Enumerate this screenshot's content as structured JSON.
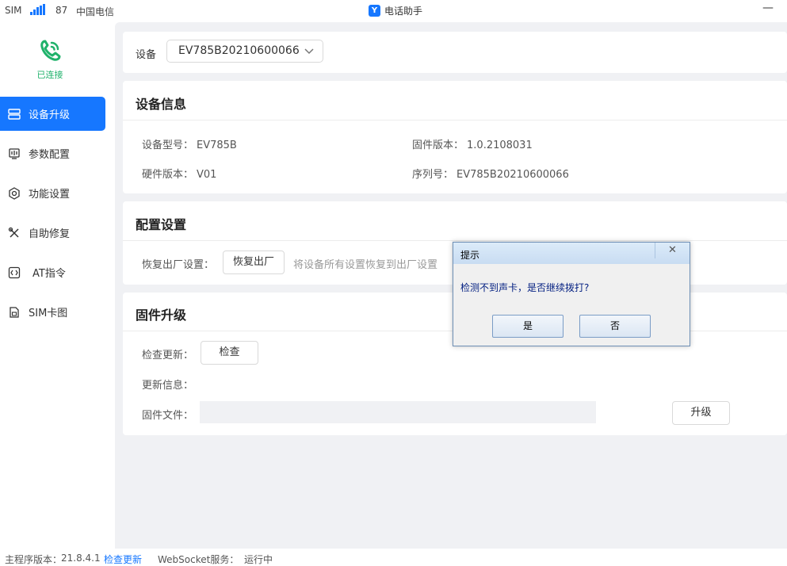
{
  "statusbar": {
    "sim_label": "SIM",
    "signal_value": "87",
    "carrier": "中国电信"
  },
  "window": {
    "app_title": "电话助手",
    "minimize_glyph": "—"
  },
  "sidebar": {
    "connection_status": "已连接",
    "items": [
      {
        "label": "设备升级",
        "icon": "chip-icon",
        "active": true
      },
      {
        "label": "参数配置",
        "icon": "parameters-icon",
        "active": false
      },
      {
        "label": "功能设置",
        "icon": "gear-icon",
        "active": false
      },
      {
        "label": "自助修复",
        "icon": "tools-icon",
        "active": false
      },
      {
        "label": "AT指令",
        "icon": "code-icon",
        "active": false
      },
      {
        "label": "SIM卡图",
        "icon": "sim-card-icon",
        "active": false
      }
    ]
  },
  "device": {
    "label": "设备",
    "selected": "EV785B20210600066"
  },
  "device_info": {
    "title": "设备信息",
    "model_label": "设备型号：",
    "model_value": "EV785B",
    "firmware_label": "固件版本：",
    "firmware_value": "1.0.2108031",
    "hardware_label": "硬件版本：",
    "hardware_value": "V01",
    "serial_label": "序列号：",
    "serial_value": "EV785B20210600066"
  },
  "config": {
    "title": "配置设置",
    "reset_label": "恢复出厂设置：",
    "reset_button": "恢复出厂",
    "reset_hint": "将设备所有设置恢复到出厂设置"
  },
  "firmware": {
    "title": "固件升级",
    "check_label": "检查更新：",
    "check_button": "检查",
    "info_label": "更新信息：",
    "file_label": "固件文件：",
    "upgrade_button": "升级"
  },
  "footer": {
    "version_label": "主程序版本：",
    "version_value": "21.8.4.1",
    "check_update_link": "检查更新",
    "websocket_label": "WebSocket服务：",
    "websocket_status": "运行中"
  },
  "dialog": {
    "title": "提示",
    "close_glyph": "✕",
    "message": "检测不到声卡，是否继续拨打?",
    "yes_button": "是",
    "no_button": "否"
  },
  "colors": {
    "accent": "#1677ff",
    "connected": "#20b26b"
  }
}
